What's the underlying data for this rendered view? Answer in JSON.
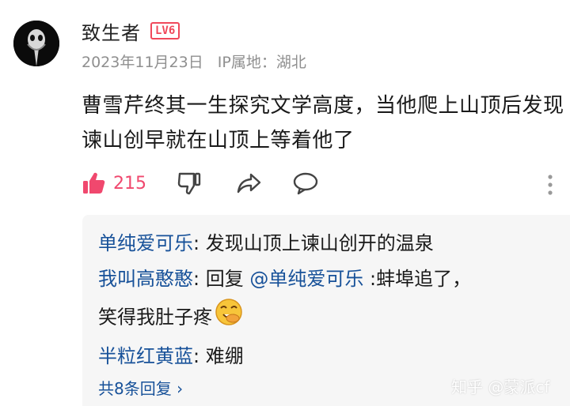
{
  "author": {
    "name": "致生者",
    "level_badge": "LV6",
    "date": "2023年11月23日",
    "ip_label": "IP属地：湖北"
  },
  "comment": {
    "text": "曹雪芹终其一生探究文学高度，当他爬上山顶后发现谏山创早就在山顶上等着他了"
  },
  "actions": {
    "like_count": "215"
  },
  "replies": [
    {
      "user": "单纯爱可乐",
      "sep": ": ",
      "text": "发现山顶上谏山创开的温泉"
    },
    {
      "user": "我叫高憨憨",
      "sep": ": ",
      "prefix": "回复 ",
      "mention": "@单纯爱可乐",
      "text": " :蚌埠追了，",
      "text2": "笑得我肚子疼"
    },
    {
      "user": "半粒红黄蓝",
      "sep": ": ",
      "text": "难绷"
    }
  ],
  "more_replies": "共8条回复 ›",
  "watermark": "知乎 @蒙派cf",
  "colors": {
    "accent_link": "#175199",
    "like": "#f0486e",
    "badge": "#f0485a"
  }
}
